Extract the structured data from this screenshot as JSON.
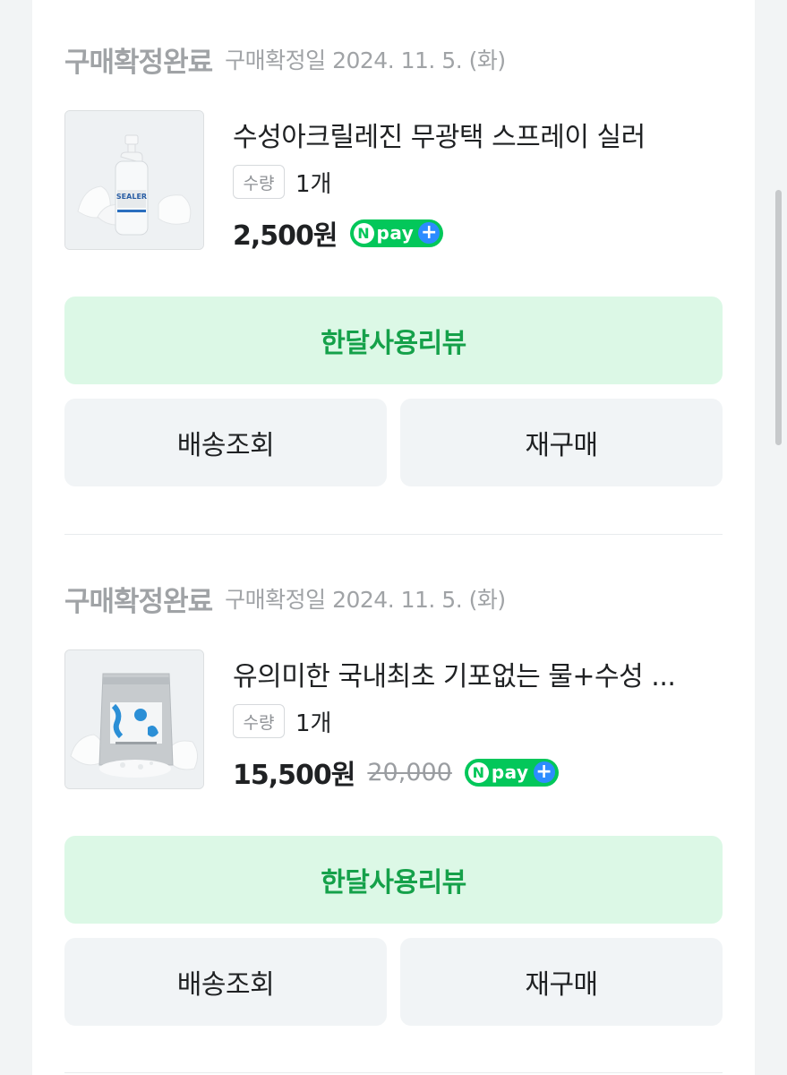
{
  "orders": [
    {
      "status": "구매확정완료",
      "confirm_date": "구매확정일 2024. 11. 5. (화)",
      "product_name": "수성아크릴레진 무광택 스프레이 실러",
      "qty_label": "수량",
      "qty_value": "1개",
      "price": "2,500원",
      "original_price": "",
      "image_text": "SEALER",
      "npay": {
        "n": "N",
        "text": "pay",
        "plus": "+"
      },
      "review_label": "한달사용리뷰",
      "delivery_label": "배송조회",
      "rebuy_label": "재구매"
    },
    {
      "status": "구매확정완료",
      "confirm_date": "구매확정일 2024. 11. 5. (화)",
      "product_name": "유의미한 국내최초 기포없는 물+수성 ...",
      "qty_label": "수량",
      "qty_value": "1개",
      "price": "15,500원",
      "original_price": "20,000",
      "image_text": "",
      "npay": {
        "n": "N",
        "text": "pay",
        "plus": "+"
      },
      "review_label": "한달사용리뷰",
      "delivery_label": "배송조회",
      "rebuy_label": "재구매"
    }
  ],
  "colors": {
    "accent_green": "#15a14a",
    "review_bg": "#dcf8e6",
    "npay_green": "#03c75a",
    "npay_blue": "#2d8cff"
  }
}
